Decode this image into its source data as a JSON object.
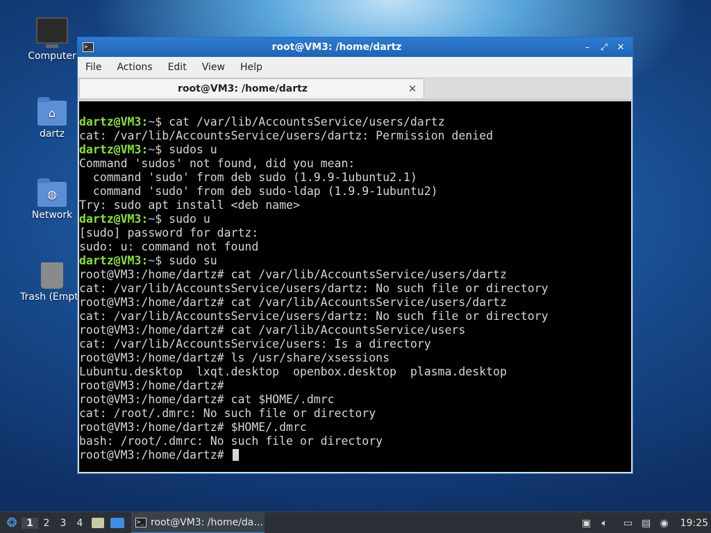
{
  "desktop": {
    "icons": [
      {
        "label": "Computer",
        "icon": "computer-icon"
      },
      {
        "label": "dartz",
        "icon": "home-folder-icon"
      },
      {
        "label": "Network",
        "icon": "network-folder-icon"
      },
      {
        "label": "Trash (Empty)",
        "icon": "trash-icon"
      }
    ]
  },
  "window": {
    "title": "root@VM3: /home/dartz",
    "controls": {
      "minimize": "–",
      "maximize": "⤢",
      "close": "✕"
    }
  },
  "menu": {
    "file": "File",
    "actions": "Actions",
    "edit": "Edit",
    "view": "View",
    "help": "Help"
  },
  "tab": {
    "label": "root@VM3: /home/dartz",
    "close": "✕"
  },
  "terminal": {
    "lines": [
      {
        "user": "dartz@VM3",
        "path": "~",
        "sym": "$ ",
        "cmd": "cat /var/lib/AccountsService/users/dartz"
      },
      {
        "text": "cat: /var/lib/AccountsService/users/dartz: Permission denied"
      },
      {
        "user": "dartz@VM3",
        "path": "~",
        "sym": "$ ",
        "cmd": "sudos u"
      },
      {
        "text": "Command 'sudos' not found, did you mean:"
      },
      {
        "text": "  command 'sudo' from deb sudo (1.9.9-1ubuntu2.1)"
      },
      {
        "text": "  command 'sudo' from deb sudo-ldap (1.9.9-1ubuntu2)"
      },
      {
        "text": "Try: sudo apt install <deb name>"
      },
      {
        "user": "dartz@VM3",
        "path": "~",
        "sym": "$ ",
        "cmd": "sudo u"
      },
      {
        "text": "[sudo] password for dartz:"
      },
      {
        "text": "sudo: u: command not found"
      },
      {
        "user": "dartz@VM3",
        "path": "~",
        "sym": "$ ",
        "cmd": "sudo su"
      },
      {
        "text": "root@VM3:/home/dartz# cat /var/lib/AccountsService/users/dartz"
      },
      {
        "text": "cat: /var/lib/AccountsService/users/dartz: No such file or directory"
      },
      {
        "text": "root@VM3:/home/dartz# cat /var/lib/AccountsService/users/dartz"
      },
      {
        "text": "cat: /var/lib/AccountsService/users/dartz: No such file or directory"
      },
      {
        "text": "root@VM3:/home/dartz# cat /var/lib/AccountsService/users"
      },
      {
        "text": "cat: /var/lib/AccountsService/users: Is a directory"
      },
      {
        "text": "root@VM3:/home/dartz# ls /usr/share/xsessions"
      },
      {
        "text": "Lubuntu.desktop  lxqt.desktop  openbox.desktop  plasma.desktop"
      },
      {
        "text": "root@VM3:/home/dartz#"
      },
      {
        "text": "root@VM3:/home/dartz# cat $HOME/.dmrc"
      },
      {
        "text": "cat: /root/.dmrc: No such file or directory"
      },
      {
        "text": "root@VM3:/home/dartz# $HOME/.dmrc"
      },
      {
        "text": "bash: /root/.dmrc: No such file or directory"
      },
      {
        "text": "root@VM3:/home/dartz# ",
        "cursor": true
      }
    ]
  },
  "taskbar": {
    "workspaces": [
      "1",
      "2",
      "3",
      "4"
    ],
    "active_workspace": "1",
    "task_label": "root@VM3: /home/da…",
    "clock": "19:25"
  },
  "colors": {
    "prompt_user": "#8ae234",
    "prompt_path": "#729fcf",
    "titlebar": "#1d64b8"
  }
}
